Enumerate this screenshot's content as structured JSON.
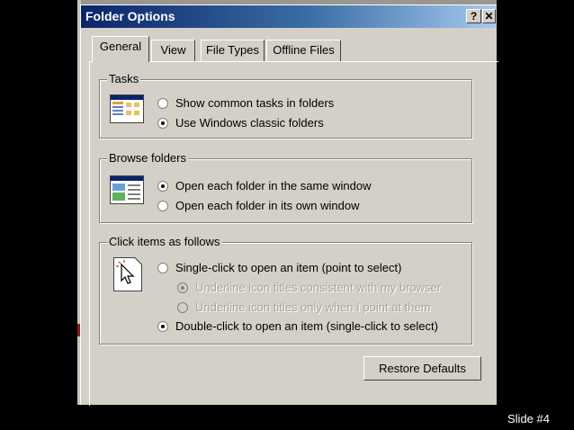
{
  "window": {
    "title": "Folder Options",
    "help_glyph": "?",
    "close_glyph": "✕"
  },
  "tabs": [
    {
      "label": "General",
      "active": true
    },
    {
      "label": "View",
      "active": false
    },
    {
      "label": "File Types",
      "active": false
    },
    {
      "label": "Offline Files",
      "active": false
    }
  ],
  "groups": {
    "tasks": {
      "label": "Tasks",
      "options": [
        {
          "label": "Show common tasks in folders",
          "checked": false
        },
        {
          "label": "Use Windows classic folders",
          "checked": true
        }
      ]
    },
    "browse": {
      "label": "Browse folders",
      "options": [
        {
          "label": "Open each folder in the same window",
          "checked": true
        },
        {
          "label": "Open each folder in its own window",
          "checked": false
        }
      ]
    },
    "click": {
      "label": "Click items as follows",
      "options": [
        {
          "label": "Single-click to open an item (point to select)",
          "checked": false,
          "enabled": true
        },
        {
          "label": "Underline icon titles consistent with my browser",
          "checked": true,
          "enabled": false
        },
        {
          "label": "Underline icon titles only when I point at them",
          "checked": false,
          "enabled": false
        },
        {
          "label": "Double-click to open an item (single-click to select)",
          "checked": true,
          "enabled": true
        }
      ]
    }
  },
  "buttons": {
    "restore_defaults": "Restore Defaults"
  },
  "slide": {
    "label": "Slide  #4"
  },
  "icons": {
    "tasks": "folder-window-icon",
    "browse": "browse-window-icon",
    "click": "pointer-click-icon"
  },
  "colors": {
    "titlebar_start": "#0a246a",
    "titlebar_end": "#a6caf0",
    "face": "#d4d0c8"
  }
}
